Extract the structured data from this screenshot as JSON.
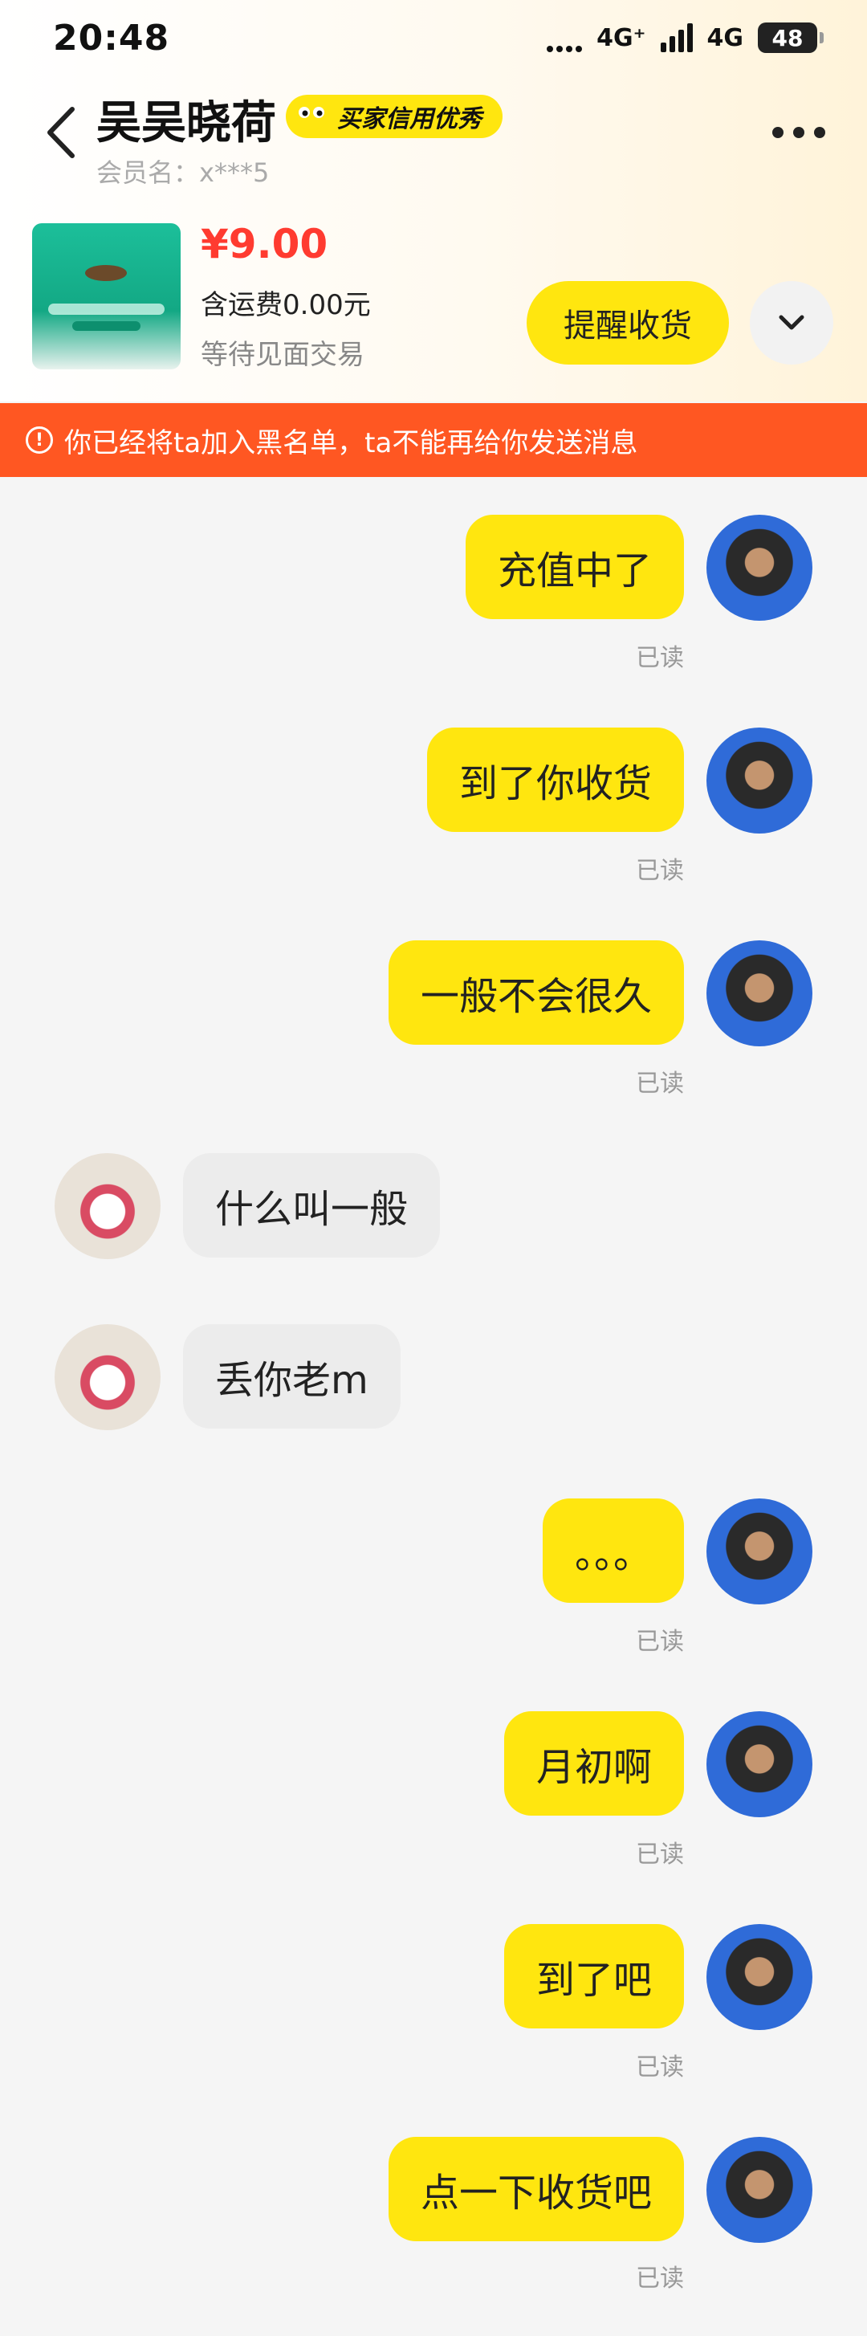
{
  "status_bar": {
    "time": "20:48",
    "net1": "4G⁺",
    "net2": "4G",
    "battery": "48"
  },
  "header": {
    "name": "吴吴晓荷",
    "credit_badge": "买家信用优秀",
    "member_label": "会员名：x***5"
  },
  "product": {
    "price": "¥9.00",
    "shipping": "含运费0.00元",
    "status": "等待见面交易",
    "remind_button": "提醒收货"
  },
  "banner": {
    "text": "你已经将ta加入黑名单，ta不能再给你发送消息"
  },
  "messages": [
    {
      "side": "mine",
      "text": "充值中了",
      "read": "已读"
    },
    {
      "side": "mine",
      "text": "到了你收货",
      "read": "已读"
    },
    {
      "side": "mine",
      "text": "一般不会很久",
      "read": "已读"
    },
    {
      "side": "theirs",
      "text": "什么叫一般"
    },
    {
      "side": "theirs",
      "text": "丢你老m"
    },
    {
      "side": "mine",
      "text": "。。。",
      "read": "已读"
    },
    {
      "side": "mine",
      "text": "月初啊",
      "read": "已读"
    },
    {
      "side": "mine",
      "text": "到了吧",
      "read": "已读"
    },
    {
      "side": "mine",
      "text": "点一下收货吧",
      "read": "已读"
    }
  ]
}
